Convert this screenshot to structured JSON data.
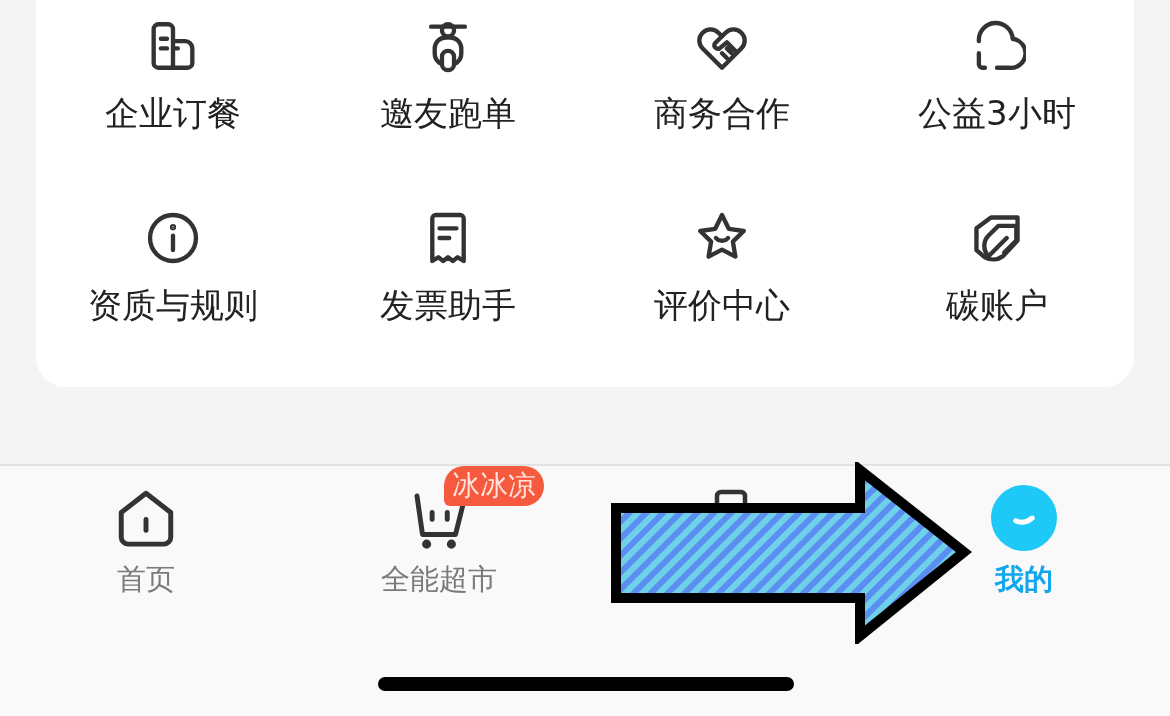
{
  "services": [
    {
      "label": "企业订餐"
    },
    {
      "label": "邀友跑单"
    },
    {
      "label": "商务合作"
    },
    {
      "label": "公益3小时"
    },
    {
      "label": "资质与规则"
    },
    {
      "label": "发票助手"
    },
    {
      "label": "评价中心"
    },
    {
      "label": "碳账户"
    }
  ],
  "tab_bar": [
    {
      "label": "首页",
      "selected": false
    },
    {
      "label": "全能超市",
      "selected": false,
      "badge": "冰冰凉"
    },
    {
      "label": "我的",
      "selected": true
    }
  ]
}
